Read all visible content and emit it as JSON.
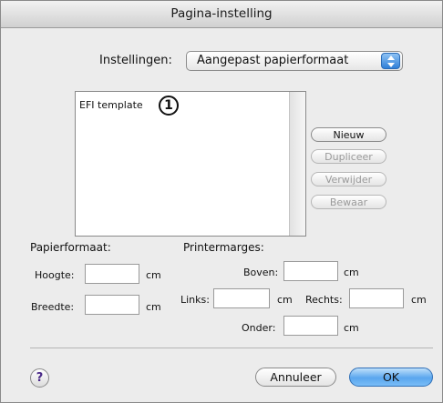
{
  "window": {
    "title": "Pagina-instelling"
  },
  "settings": {
    "label": "Instellingen:",
    "value": "Aangepast papierformaat"
  },
  "list": {
    "items": [
      "EFI template"
    ],
    "callout": "1"
  },
  "side_buttons": {
    "new": "Nieuw",
    "duplicate": "Dupliceer",
    "delete": "Verwijder",
    "save": "Bewaar"
  },
  "paper_size": {
    "heading": "Papierformaat:",
    "height_label": "Hoogte:",
    "width_label": "Breedte:",
    "unit": "cm",
    "height_value": "",
    "width_value": ""
  },
  "margins": {
    "heading": "Printermarges:",
    "top_label": "Boven:",
    "left_label": "Links:",
    "right_label": "Rechts:",
    "bottom_label": "Onder:",
    "unit": "cm",
    "top_value": "",
    "left_value": "",
    "right_value": "",
    "bottom_value": ""
  },
  "footer": {
    "help": "?",
    "cancel": "Annuleer",
    "ok": "OK"
  },
  "icons": {
    "popup": "up-down-arrows-icon",
    "help": "question-mark-icon"
  },
  "colors": {
    "default_button": "#5aa6ee",
    "popup_arrows": "#2f7fd8"
  }
}
